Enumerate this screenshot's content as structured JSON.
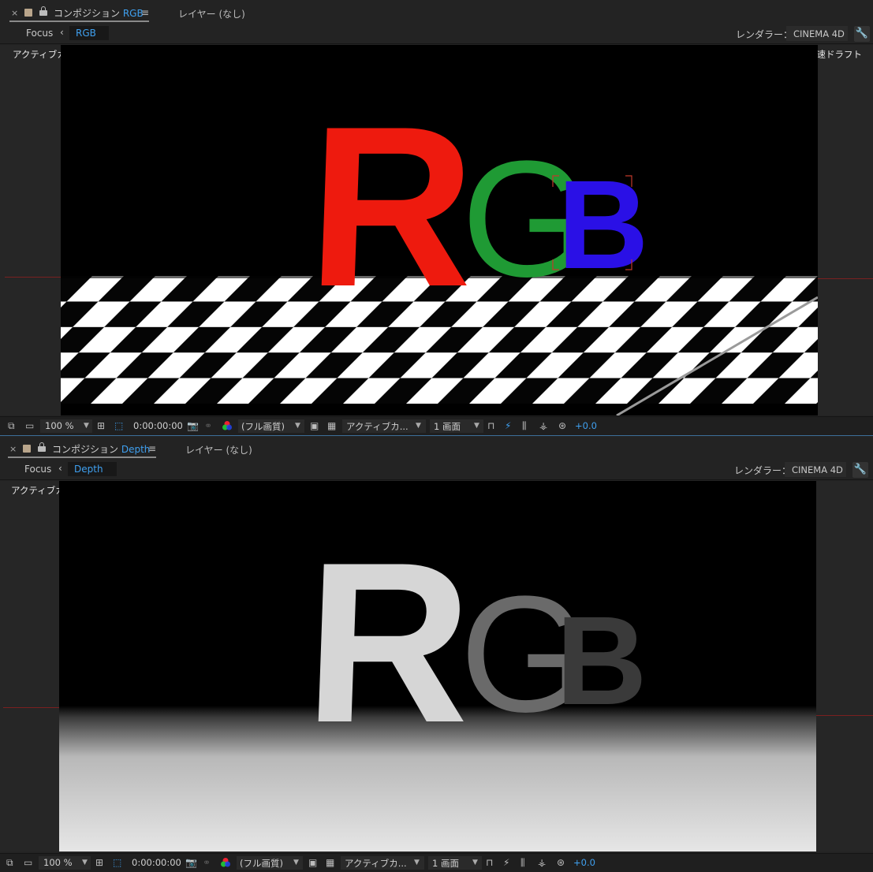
{
  "colors": {
    "accent": "#3fa0f0",
    "red": "#ee1a0e",
    "green": "#1f9a34",
    "blue": "#2a10e6"
  },
  "panels": [
    {
      "tab": {
        "close": "×",
        "prefix": "コンポジション ",
        "comp": "RGB",
        "menu": "≡",
        "layer": "レイヤー (なし)"
      },
      "focus": {
        "label": "Focus",
        "crumb": "RGB"
      },
      "renderer": {
        "label": "レンダラー：",
        "value": "CINEMA 4D"
      },
      "viewer": {
        "camera": "アクティブカメラ",
        "draft": "高速ドラフト",
        "text": "RGB"
      },
      "status": {
        "zoom": "100 %",
        "timecode": "0:00:00:00",
        "quality": "(フル画質)",
        "camera": "アクティブカ...",
        "views": "1 画面",
        "exposure": "+0.0"
      }
    },
    {
      "tab": {
        "close": "×",
        "prefix": "コンポジション ",
        "comp": "Depth",
        "menu": "≡",
        "layer": "レイヤー (なし)"
      },
      "focus": {
        "label": "Focus",
        "crumb": "Depth"
      },
      "renderer": {
        "label": "レンダラー：",
        "value": "CINEMA 4D"
      },
      "viewer": {
        "camera": "アクティブカメラ",
        "text": "RGB"
      },
      "status": {
        "zoom": "100 %",
        "timecode": "0:00:00:00",
        "quality": "(フル画質)",
        "camera": "アクティブカ...",
        "views": "1 画面",
        "exposure": "+0.0"
      }
    }
  ]
}
